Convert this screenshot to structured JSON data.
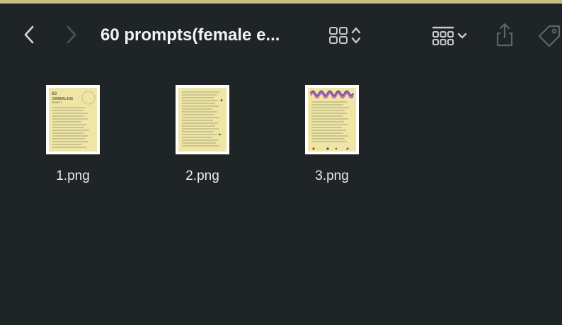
{
  "window": {
    "title": "60 prompts(female e...",
    "accent_strip_color": "#c8bf86",
    "background": "#1f2526"
  },
  "toolbar": {
    "back_icon": "chevron-left-icon",
    "forward_icon": "chevron-right-icon",
    "view_icon": "grid-view-icon",
    "group_icon": "group-by-icon",
    "share_icon": "share-icon",
    "tag_icon": "tag-icon"
  },
  "files": [
    {
      "name": "1.png"
    },
    {
      "name": "2.png"
    },
    {
      "name": "3.png"
    }
  ]
}
